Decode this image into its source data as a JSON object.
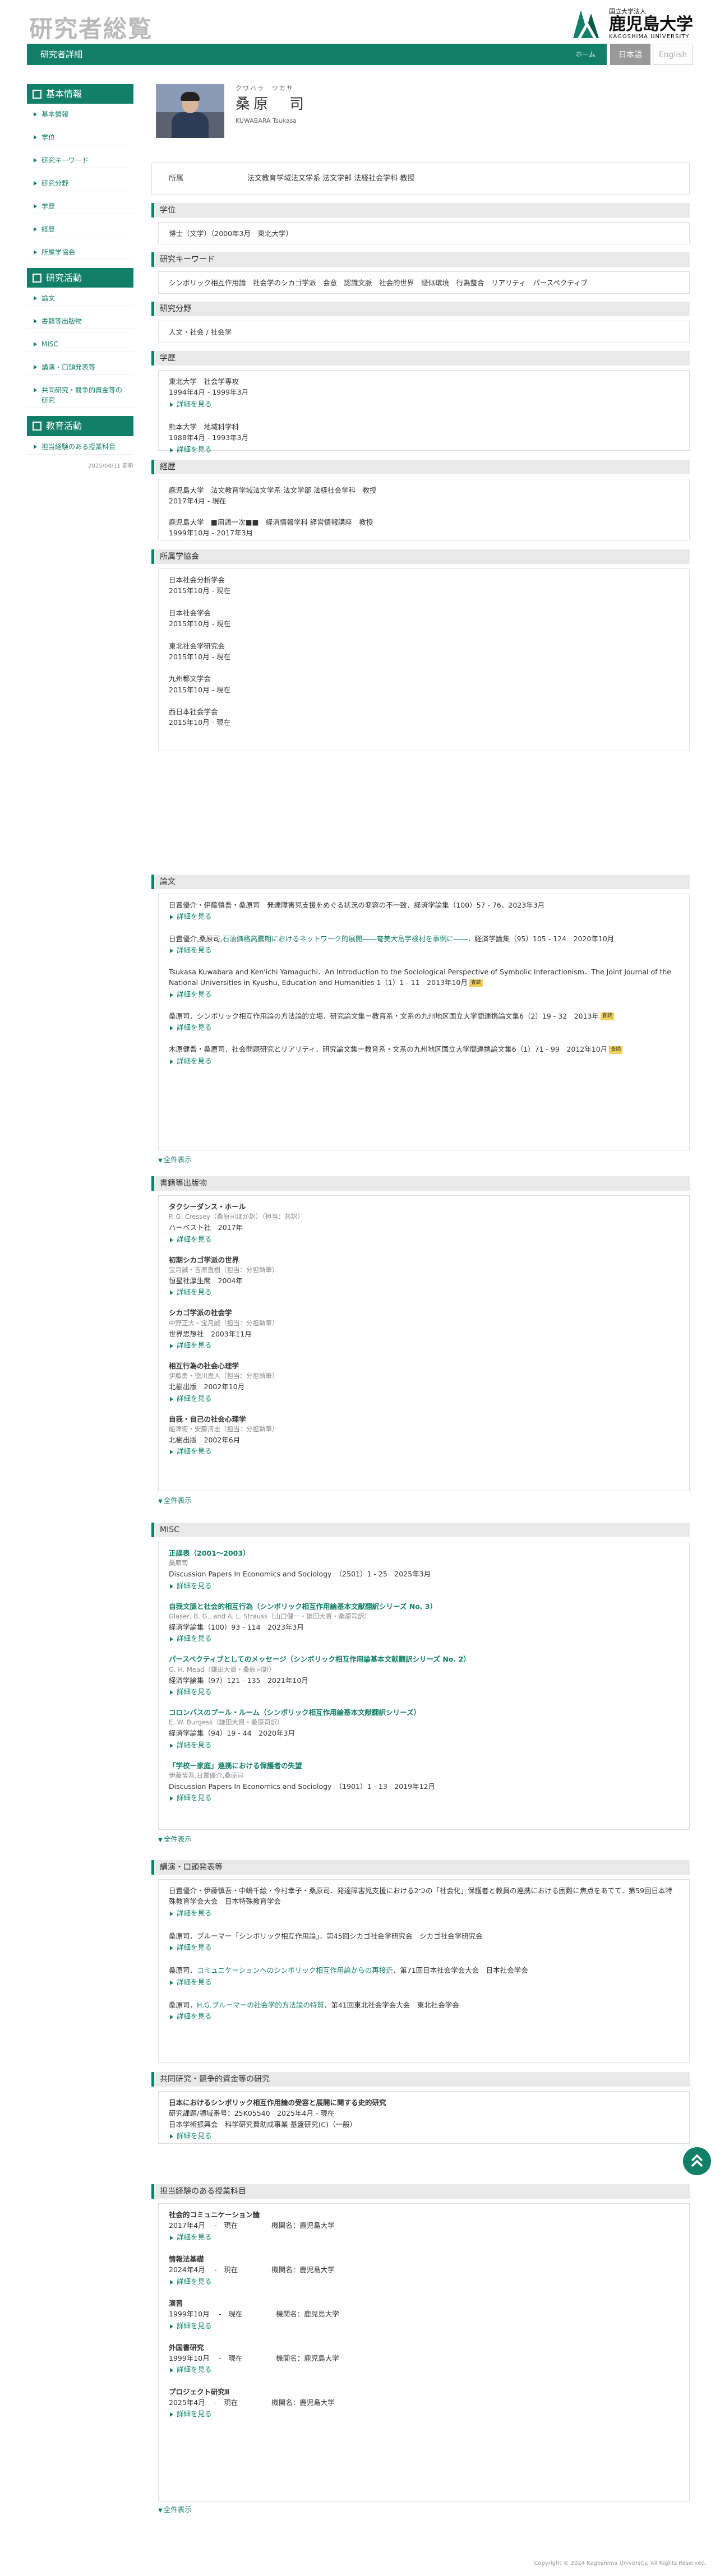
{
  "header": {
    "site_title": "研究者総覧",
    "logo_sub": "国立大学法人",
    "logo_ja": "鹿児島大学",
    "logo_en": "KAGOSHIMA UNIVERSITY",
    "bar_title": "研究者詳細",
    "home": "ホーム",
    "lang_ja": "日本語",
    "lang_en": "English"
  },
  "sidebar": {
    "basic_head": "基本情報",
    "basic_items": [
      "基本情報",
      "学位",
      "研究キーワード",
      "研究分野",
      "学歴",
      "経歴",
      "所属学協会"
    ],
    "research_head": "研究活動",
    "research_items": [
      "論文",
      "書籍等出版物",
      "MISC",
      "講演・口頭発表等",
      "共同研究・競争的資金等の研究"
    ],
    "edu_head": "教育活動",
    "edu_items": [
      "担当経験のある授業科目"
    ],
    "updated": "2025/04/11 更新"
  },
  "profile": {
    "kana": "クワハラ　ツカサ",
    "name": "桑原　司",
    "roman": "KUWABARA Tsukasa",
    "aff_label": "所属",
    "aff_value": "法文教育学域法文学系 法文学部 法経社会学科 教授"
  },
  "degree": {
    "head": "学位",
    "text": "博士（文学）（2000年3月　東北大学）"
  },
  "keywords": {
    "head": "研究キーワード",
    "text": "シンボリック相互作用論　社会学のシカゴ学派　会意　認識文脈　社会的世界　疑似環境　行為整合　リアリティ　パースペクティブ"
  },
  "fields": {
    "head": "研究分野",
    "text": "人文・社会 / 社会学"
  },
  "education": {
    "head": "学歴",
    "more": "詳細を見る",
    "items": [
      {
        "l1": "東北大学　社会学専攻",
        "l2": "1994年4月 - 1999年3月"
      },
      {
        "l1": "熊本大学　地域科学科",
        "l2": "1988年4月 - 1993年3月"
      }
    ]
  },
  "career": {
    "head": "経歴",
    "items": [
      {
        "l1": "鹿児島大学　法文教育学域法文学系 法文学部 法経社会学科　教授",
        "l2": "2017年4月 - 現在"
      },
      {
        "l1": "鹿児島大学　■用語一次■■　経済情報学科 経営情報講座　教授",
        "l2": "1999年10月 - 2017年3月"
      }
    ]
  },
  "societies": {
    "head": "所属学協会",
    "items": [
      {
        "l1": "日本社会分析学会",
        "l2": "2015年10月 - 現在"
      },
      {
        "l1": "日本社会学会",
        "l2": "2015年10月 - 現在"
      },
      {
        "l1": "東北社会学研究会",
        "l2": "2015年10月 - 現在"
      },
      {
        "l1": "九州都文学会",
        "l2": "2015年10月 - 現在"
      },
      {
        "l1": "西日本社会学会",
        "l2": "2015年10月 - 現在"
      }
    ]
  },
  "papers": {
    "head": "論文",
    "show_all": "全件表示",
    "more": "詳細を見る",
    "items": [
      {
        "text": "日置優介・伊藤慎吾・桑原司　発達障害児支援をめぐる状況の変容の不一致．経済学論集（100）57 - 76．2023年3月"
      },
      {
        "pre": "日置優介,桑原司,",
        "link": "石油価格高騰期におけるネットワーク的展開――奄美大島宇検村を事例に――",
        "post": "．経済学論集（95）105 - 124　2020年10月"
      },
      {
        "text": "Tsukasa Kuwabara and Ken'ichi Yamaguchi．An Introduction to the Sociological Perspective of Symbolic Interactionism．The Joint Journal of the National Universities in Kyushu, Education and Humanities 1（1）1 - 11　2013年10月",
        "tag": "査読"
      },
      {
        "text": "桑原司．シンボリック相互作用論の方法論的立場．研究論文集ー教育系・文系の九州地区国立大学間連携論文集6（2）19 - 32　2013年",
        "tag": "査読"
      },
      {
        "text": "木原健吾・桑原司．社会問題研究とリアリティ．研究論文集ー教育系・文系の九州地区国立大学間連携論文集6（1）71 - 99　2012年10月",
        "tag": "査読"
      }
    ]
  },
  "books": {
    "head": "書籍等出版物",
    "show_all": "全件表示",
    "more": "詳細を見る",
    "items": [
      {
        "title": "タクシーダンス・ホール",
        "authors": "P. G. Cressey（桑原司ほか訳）（担当：共訳）",
        "pub": "ハーベスト社　2017年"
      },
      {
        "title": "初期シカゴ学派の世界",
        "authors": "宝月誠・吉原直樹（担当：分担執筆）",
        "pub": "恒星社厚生閣　2004年"
      },
      {
        "title": "シカゴ学派の社会学",
        "authors": "中野正大・宝月誠（担当：分担執筆）",
        "pub": "世界思想社　2003年11月"
      },
      {
        "title": "相互行為の社会心理学",
        "authors": "伊藤勇・徳川直人（担当：分担執筆）",
        "pub": "北樹出版　2002年10月"
      },
      {
        "title": "自我・自己の社会心理学",
        "authors": "船津衛・安藤清志（担当：分担執筆）",
        "pub": "北樹出版　2002年6月"
      }
    ]
  },
  "misc": {
    "head": "MISC",
    "show_all": "全件表示",
    "more": "詳細を見る",
    "items": [
      {
        "title": "正誤表（2001〜2003）",
        "authors": "桑原司",
        "pub": "Discussion Papers In Economics and Sociology　（2501）1 - 25　2025年3月"
      },
      {
        "title": "自我文脈と社会的相互行為（シンボリック相互作用論基本文献翻訳シリーズ No. 3）",
        "authors": "Glaser, B. G., and A. L. Strauss（山口健一・鎌田大資・桑原司訳）",
        "pub": "経済学論集（100）93 - 114　2023年3月"
      },
      {
        "title": "パースペクティブとしてのメッセージ（シンボリック相互作用論基本文献翻訳シリーズ No. 2）",
        "authors": "G. H. Mead（鎌田大資・桑原司訳）",
        "pub": "経済学論集（97）121 - 135　2021年10月"
      },
      {
        "title": "コロンバスのプール・ルーム（シンボリック相互作用論基本文献翻訳シリーズ）",
        "authors": "E. W. Burgess（鎌田大資・桑原司訳）",
        "pub": "経済学論集（94）19 - 44　2020年3月"
      },
      {
        "title": "「学校ー家庭」連携における保護者の失望",
        "authors": "伊藤慎吾,日置優介,桑原司",
        "pub": "Discussion Papers In Economics and Sociology　（1901）1 - 13　2019年12月"
      }
    ]
  },
  "talks": {
    "head": "講演・口頭発表等",
    "more": "詳細を見る",
    "items": [
      {
        "text": "日置優介・伊藤慎吾・中嶋千絵・今村幸子・桑原司．発達障害児支援における2つの「社会化」保護者と教員の連携における困難に焦点をあてて．第59回日本特殊教育学会大会　日本特殊教育学会"
      },
      {
        "pre": "桑原司．ブルーマー「シンボリック相互作用論」．第45回シカゴ社会学研究会　シカゴ社会学研究会"
      },
      {
        "pre": "桑原司．",
        "link": "コミュニケーションへのシンボリック相互作用論からの再接近",
        "post": "．第71回日本社会学会大会　日本社会学会"
      },
      {
        "pre": "桑原司．",
        "link": "H.G.ブルーマーの社会学的方法論の特質",
        "post": "．第41回東北社会学会大会　東北社会学会"
      }
    ]
  },
  "grants": {
    "head": "共同研究・競争的資金等の研究",
    "more": "詳細を見る",
    "title": "日本におけるシンボリック相互作用論の受容と展開に関する史的研究",
    "l2": "研究課題/領域番号：25K05540　2025年4月 - 現在",
    "l3": "日本学術振興会　科学研究費助成事業 基盤研究(C)（一般）"
  },
  "courses": {
    "head": "担当経験のある授業科目",
    "show_all": "全件表示",
    "more": "詳細を見る",
    "inst_label": "機関名：",
    "items": [
      {
        "title": "社会的コミュニケーション論",
        "period": "2017年4月　 -　現在",
        "inst": "鹿児島大学"
      },
      {
        "title": "情報法基礎",
        "period": "2024年4月　 -　現在",
        "inst": "鹿児島大学"
      },
      {
        "title": "演習",
        "period": "1999年10月　 -　現在",
        "inst": "鹿児島大学"
      },
      {
        "title": "外国書研究",
        "period": "1999年10月　 -　現在",
        "inst": "鹿児島大学"
      },
      {
        "title": "プロジェクト研究Ⅱ",
        "period": "2025年4月　 -　現在",
        "inst": "鹿児島大学"
      }
    ]
  },
  "footer": "Copyright © 2024 Kagoshima University. All Rights Reserved."
}
